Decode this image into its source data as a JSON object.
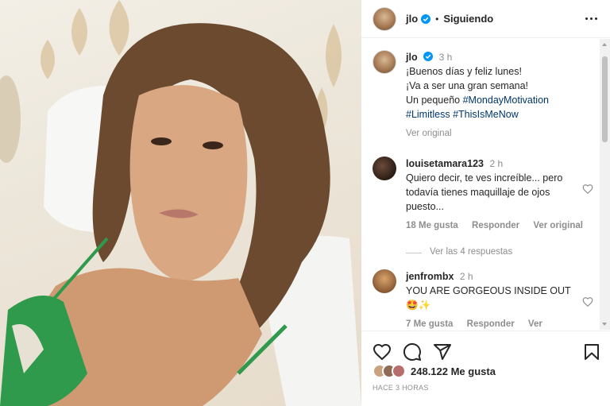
{
  "header": {
    "username": "jlo",
    "separator": "•",
    "follow_status": "Siguiendo"
  },
  "post": {
    "username": "jlo",
    "time": "3 h",
    "caption_line1": "¡Buenos días y feliz lunes!",
    "caption_line2": "¡Va a ser una gran semana!",
    "caption_line3_prefix": "Un pequeño ",
    "hashtag1": "#MondayMotivation",
    "hashtag2": "#Limitless",
    "hashtag3": "#ThisIsMeNow",
    "see_original": "Ver original"
  },
  "comments": [
    {
      "username": "louisetamara123",
      "time": "2 h",
      "text": "Quiero decir, te ves increíble... pero todavía tienes maquillaje de ojos puesto...",
      "likes": "18 Me gusta",
      "reply": "Responder",
      "extra": "Ver original",
      "view_replies": "Ver las 4 respuestas"
    },
    {
      "username": "jenfrombx",
      "time": "2 h",
      "text": "YOU ARE GORGEOUS INSIDE OUT",
      "emojis": "🤩✨",
      "likes": "7 Me gusta",
      "reply": "Responder",
      "extra": "Ver traducción"
    }
  ],
  "footer": {
    "likes_count": "248.122 Me gusta",
    "time_ago": "HACE 3 HORAS"
  },
  "icons": [
    "more-icon",
    "verified-icon",
    "heart-icon",
    "comment-icon",
    "share-icon",
    "bookmark-icon"
  ],
  "colors": {
    "link": "#00376b",
    "muted": "#8e8e8e",
    "verified": "#0095f6",
    "text": "#262626"
  }
}
